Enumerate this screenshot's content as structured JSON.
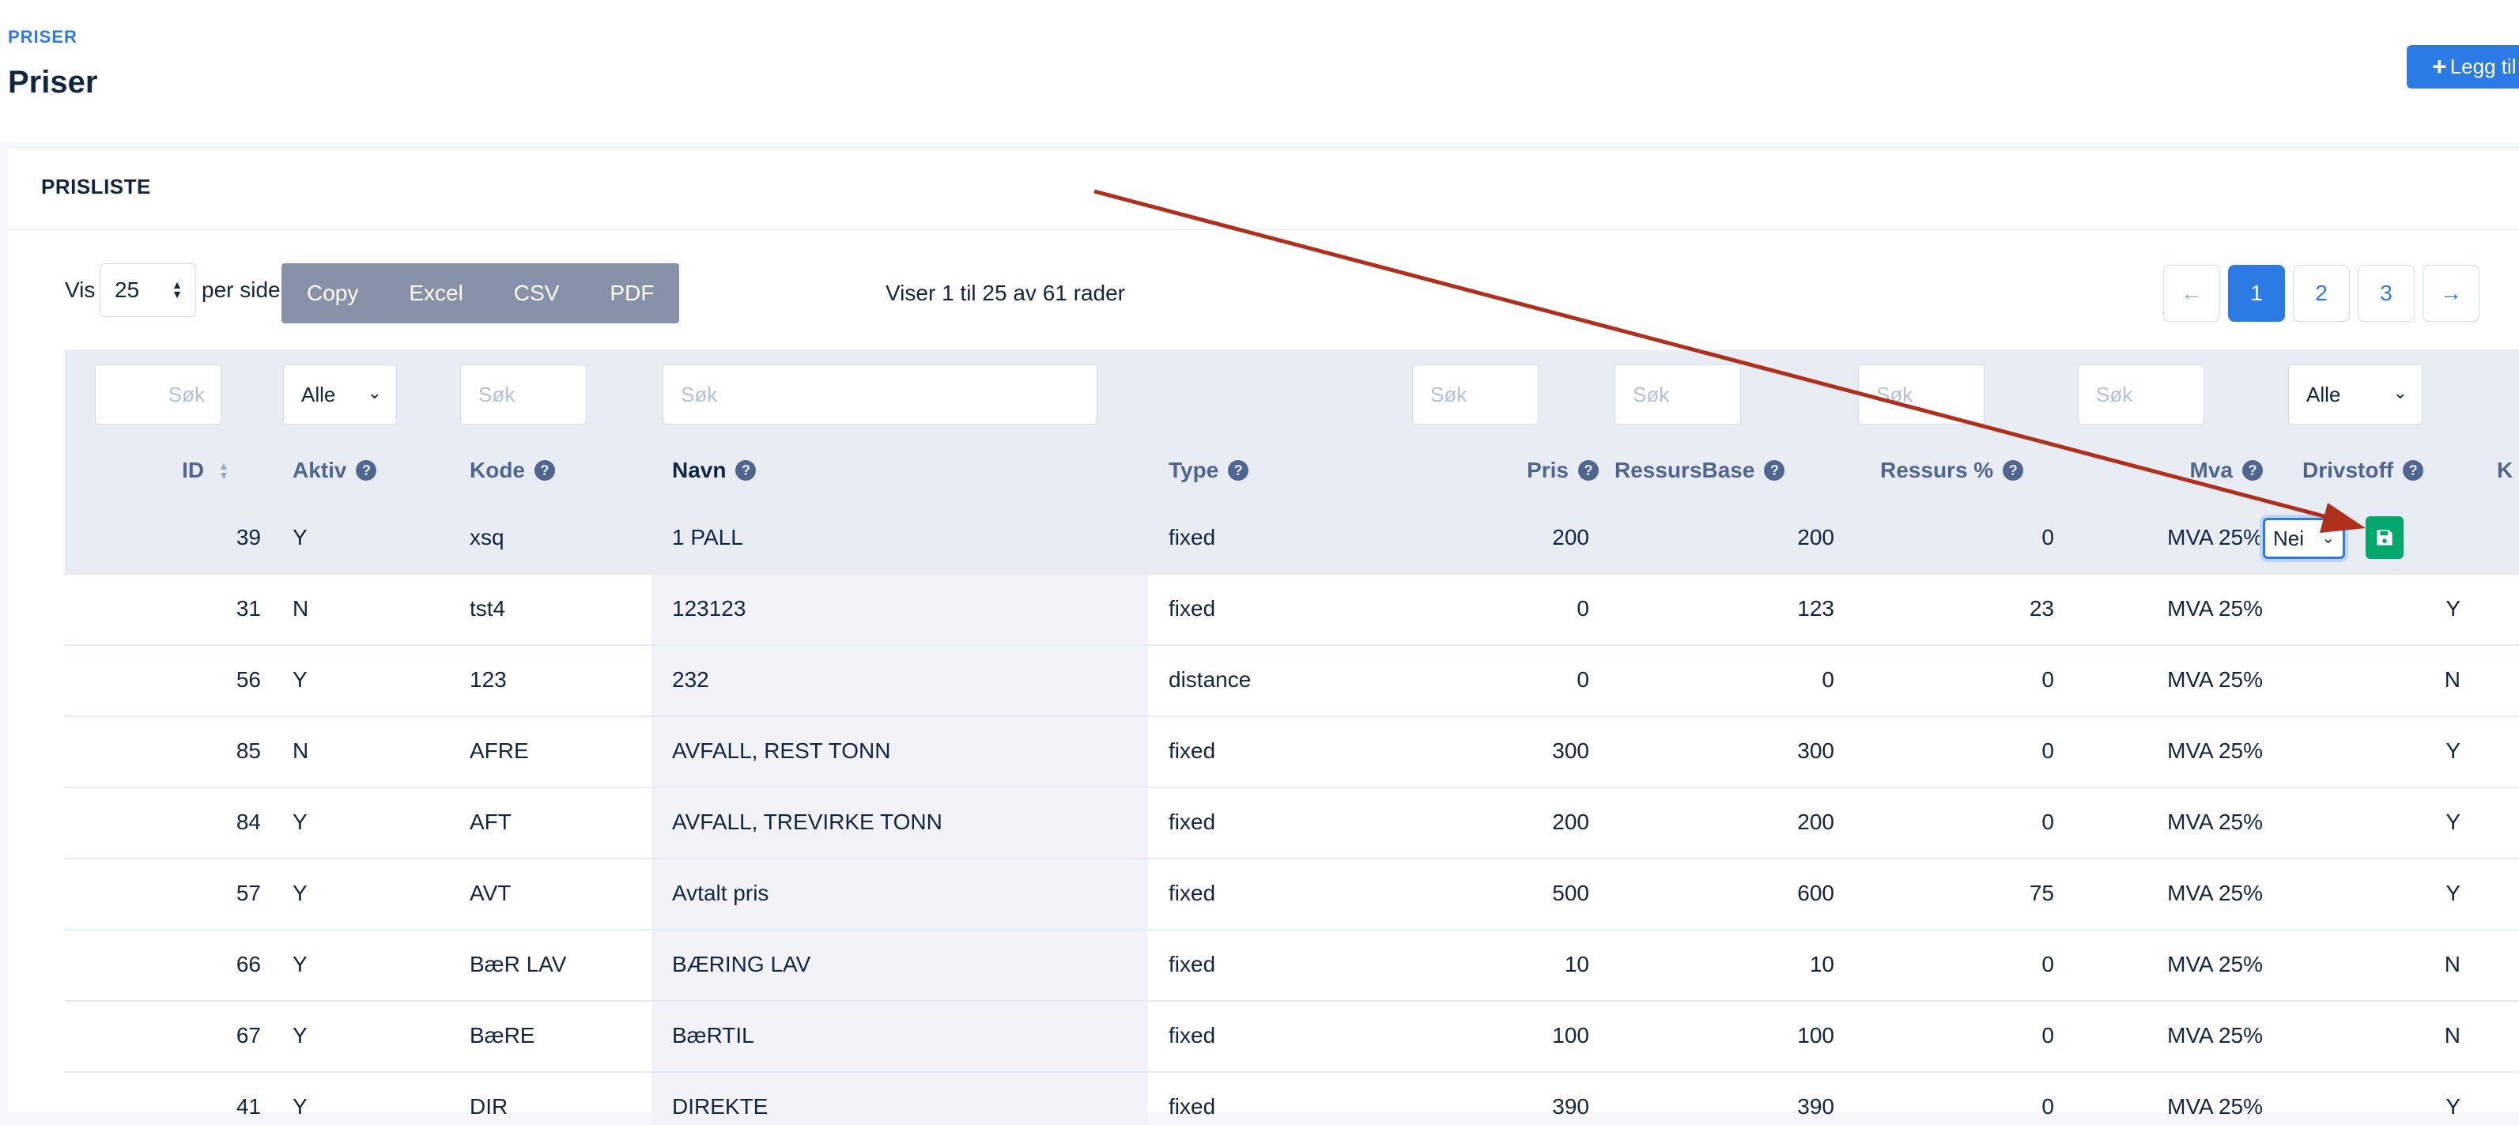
{
  "header": {
    "pretitle": "PRISER",
    "title": "Priser",
    "add_label": "Legg til"
  },
  "card": {
    "title": "PRISLISTE"
  },
  "controls": {
    "vis_label": "Vis",
    "page_size": "25",
    "per_side_label": "per side",
    "export_buttons": [
      "Copy",
      "Excel",
      "CSV",
      "PDF"
    ],
    "info": "Viser 1 til 25 av 61 rader"
  },
  "pagination": {
    "prev": "←",
    "pages": [
      "1",
      "2",
      "3"
    ],
    "active": "1",
    "next": "→"
  },
  "filters": {
    "id_placeholder": "Søk",
    "aktiv_value": "Alle",
    "kode_placeholder": "Søk",
    "navn_placeholder": "Søk",
    "pris_placeholder": "Søk",
    "ressursbase_placeholder": "Søk",
    "ressurs_placeholder": "Søk",
    "mva_placeholder": "Søk",
    "drivstoff_value": "Alle"
  },
  "columns": [
    "ID",
    "Aktiv",
    "Kode",
    "Navn",
    "Type",
    "Pris",
    "RessursBase",
    "Ressurs %",
    "Mva",
    "Drivstoff",
    "K"
  ],
  "rows": [
    {
      "id": "39",
      "aktiv": "Y",
      "kode": "xsq",
      "navn": "1 PALL",
      "type": "fixed",
      "pris": "200",
      "ressursbase": "200",
      "ressurs": "0",
      "mva": "MVA 25%",
      "drivstoff": "Nei"
    },
    {
      "id": "31",
      "aktiv": "N",
      "kode": "tst4",
      "navn": "123123",
      "type": "fixed",
      "pris": "0",
      "ressursbase": "123",
      "ressurs": "23",
      "mva": "MVA 25%",
      "drivstoff": "Y"
    },
    {
      "id": "56",
      "aktiv": "Y",
      "kode": "123",
      "navn": "232",
      "type": "distance",
      "pris": "0",
      "ressursbase": "0",
      "ressurs": "0",
      "mva": "MVA 25%",
      "drivstoff": "N"
    },
    {
      "id": "85",
      "aktiv": "N",
      "kode": "AFRE",
      "navn": "AVFALL, REST TONN",
      "type": "fixed",
      "pris": "300",
      "ressursbase": "300",
      "ressurs": "0",
      "mva": "MVA 25%",
      "drivstoff": "Y"
    },
    {
      "id": "84",
      "aktiv": "Y",
      "kode": "AFT",
      "navn": "AVFALL, TREVIRKE TONN",
      "type": "fixed",
      "pris": "200",
      "ressursbase": "200",
      "ressurs": "0",
      "mva": "MVA 25%",
      "drivstoff": "Y"
    },
    {
      "id": "57",
      "aktiv": "Y",
      "kode": "AVT",
      "navn": "Avtalt pris",
      "type": "fixed",
      "pris": "500",
      "ressursbase": "600",
      "ressurs": "75",
      "mva": "MVA 25%",
      "drivstoff": "Y"
    },
    {
      "id": "66",
      "aktiv": "Y",
      "kode": "BæR LAV",
      "navn": "BÆRING LAV",
      "type": "fixed",
      "pris": "10",
      "ressursbase": "10",
      "ressurs": "0",
      "mva": "MVA 25%",
      "drivstoff": "N"
    },
    {
      "id": "67",
      "aktiv": "Y",
      "kode": "BæRE",
      "navn": "BæRTIL",
      "type": "fixed",
      "pris": "100",
      "ressursbase": "100",
      "ressurs": "0",
      "mva": "MVA 25%",
      "drivstoff": "N"
    },
    {
      "id": "41",
      "aktiv": "Y",
      "kode": "DIR",
      "navn": "DIREKTE",
      "type": "fixed",
      "pris": "390",
      "ressursbase": "390",
      "ressurs": "0",
      "mva": "MVA 25%",
      "drivstoff": "Y"
    }
  ],
  "colors": {
    "primary": "#2c7be5",
    "export_bg": "#8792a8",
    "save": "#00a96b",
    "annotation_arrow": "#b0301e"
  }
}
